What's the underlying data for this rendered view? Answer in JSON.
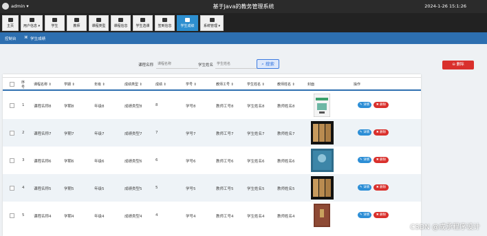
{
  "topbar": {
    "user": "admin ▾",
    "title": "基于Java的教务管理系统",
    "time": "2024-1-26 15:1:26"
  },
  "nav": [
    {
      "label": "主页",
      "icon": "home-icon"
    },
    {
      "label": "用户信息 ▾",
      "icon": "user-icon"
    },
    {
      "label": "学生",
      "icon": "student-icon"
    },
    {
      "label": "教师",
      "icon": "teacher-icon"
    },
    {
      "label": "课程类型",
      "icon": "course-type-icon"
    },
    {
      "label": "课程信息",
      "icon": "course-icon"
    },
    {
      "label": "学生选课",
      "icon": "select-course-icon"
    },
    {
      "label": "签到信息",
      "icon": "checkin-icon"
    },
    {
      "label": "学生成绩",
      "icon": "score-icon"
    },
    {
      "label": "系统管理 ▾",
      "icon": "system-icon"
    }
  ],
  "breadcrumb": {
    "home": "控制台",
    "current": "学生成绩"
  },
  "search": {
    "course_label": "课程名称",
    "course_placeholder": "课程名称",
    "student_label": "学生姓名",
    "student_placeholder": "学生姓名",
    "search_btn": "搜索",
    "delete_btn": "删除"
  },
  "table": {
    "headers": [
      "序号",
      "课程名称 ⇕",
      "学期 ⇕",
      "年级 ⇕",
      "成绩类型 ⇕",
      "成绩 ⇕",
      "学号 ⇕",
      "教师工号 ⇕",
      "学生姓名 ⇕",
      "教师姓名 ⇕",
      "封面",
      "操作"
    ],
    "rows": [
      {
        "idx": "1",
        "course": "课程名称8",
        "term": "学期8",
        "grade": "年级8",
        "type": "成绩类型8",
        "score": "8",
        "sno": "学号8",
        "tno": "教师工号8",
        "sname": "学生姓名8",
        "tname": "教师姓名8"
      },
      {
        "idx": "2",
        "course": "课程名称7",
        "term": "学期7",
        "grade": "年级7",
        "type": "成绩类型7",
        "score": "7",
        "sno": "学号7",
        "tno": "教师工号7",
        "sname": "学生姓名7",
        "tname": "教师姓名7"
      },
      {
        "idx": "3",
        "course": "课程名称6",
        "term": "学期6",
        "grade": "年级6",
        "type": "成绩类型6",
        "score": "6",
        "sno": "学号6",
        "tno": "教师工号6",
        "sname": "学生姓名6",
        "tname": "教师姓名6"
      },
      {
        "idx": "4",
        "course": "课程名称5",
        "term": "学期5",
        "grade": "年级5",
        "type": "成绩类型5",
        "score": "5",
        "sno": "学号5",
        "tno": "教师工号5",
        "sname": "学生姓名5",
        "tname": "教师姓名5"
      },
      {
        "idx": "5",
        "course": "课程名称4",
        "term": "学期4",
        "grade": "年级4",
        "type": "成绩类型4",
        "score": "4",
        "sno": "学号4",
        "tno": "教师工号4",
        "sname": "学生姓名4",
        "tname": "教师姓名4"
      }
    ],
    "edit_label": "✎ 详情",
    "del_label": "✖ 删除"
  },
  "watermark": "CSDN @成承程序设计",
  "colors": {
    "accent": "#2d6fb0",
    "danger": "#d9302c",
    "topbar": "#2b2b2b"
  }
}
